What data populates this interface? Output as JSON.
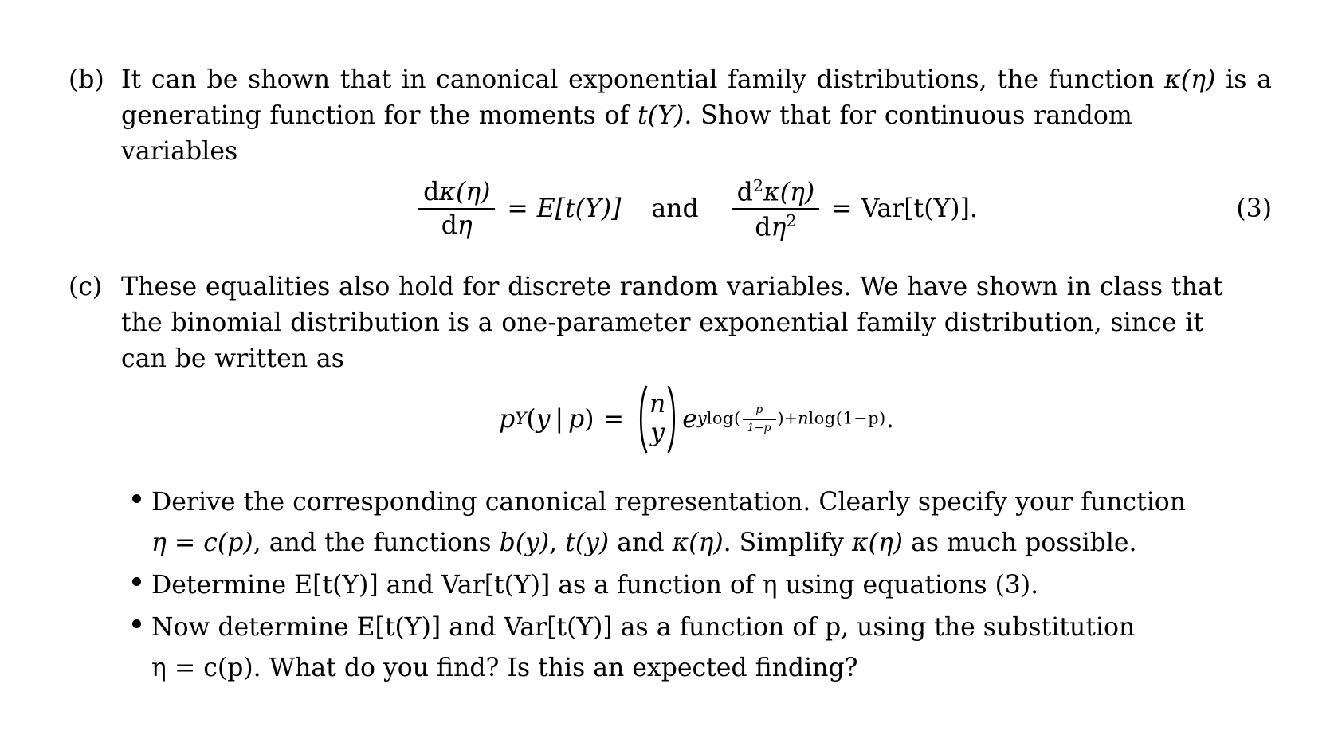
{
  "document": {
    "kind": "latex-problem-set-excerpt",
    "items": [
      {
        "id": "b",
        "label": "(b)",
        "paragraph_line1": "It can be shown that in canonical exponential family distributions, the function",
        "paragraph_kappa_eta": "κ(η)",
        "paragraph_line2a": "is a generating function for the moments of",
        "paragraph_tY": "t(Y)",
        "paragraph_line2b": ". Show that for continuous random",
        "paragraph_line3": "variables",
        "equation": {
          "tag": "(3)",
          "left": {
            "numerator_d": "d",
            "numerator_kappa": "κ",
            "numerator_arg": "(η)",
            "denominator_d": "d",
            "denominator_eta": "η",
            "equals": "=",
            "rhs": "E[t(Y)]"
          },
          "connector": "and",
          "right": {
            "numerator_d": "d",
            "numerator_exp": "2",
            "numerator_kappa": "κ",
            "numerator_arg": "(η)",
            "denominator_d": "d",
            "denominator_eta": "η",
            "denominator_exp": "2",
            "equals": "=",
            "rhs": "Var[t(Y)]."
          }
        }
      },
      {
        "id": "c",
        "label": "(c)",
        "paragraph_line1": "These equalities also hold for discrete random variables. We have shown in class that",
        "paragraph_line2": "the binomial distribution is a one-parameter exponential family distribution, since it",
        "paragraph_line3": "can be written as",
        "equation": {
          "lhs_p": "p",
          "lhs_sub": "Y",
          "lhs_open": "(",
          "lhs_y": "y",
          "lhs_bar": "|",
          "lhs_p2": "p",
          "lhs_close": ")",
          "equals": "=",
          "binom_top": "n",
          "binom_bottom": "y",
          "base_e": "e",
          "exponent_y": "y",
          "exponent_log1": "log(",
          "exponent_frac_num": "p",
          "exponent_frac_den": "1−p",
          "exponent_close1": ")",
          "exponent_plus": "+",
          "exponent_n": "n",
          "exponent_log2": "log(1−p)",
          "period": "."
        },
        "bullets": [
          {
            "text_part1": "Derive the corresponding canonical representation. Clearly specify your function",
            "text_part2a": "η = c(p)",
            "text_part2b": ", and the functions ",
            "text_part2c": "b(y)",
            "text_part2d": ", ",
            "text_part2e": "t(y)",
            "text_part2f": " and ",
            "text_part2g": "κ(η)",
            "text_part2h": ". Simplify ",
            "text_part2i": "κ(η)",
            "text_part2j": " as much possible."
          },
          {
            "text_full": "Determine E[t(Y)] and Var[t(Y)] as a function of η using equations (3)."
          },
          {
            "text_part1": "Now determine E[t(Y)] and Var[t(Y)] as a function of p, using the substitution",
            "text_part2": "η = c(p). What do you find? Is this an expected finding?"
          }
        ]
      }
    ]
  },
  "style": {
    "background_color": "#ffffff",
    "text_color": "#000000"
  }
}
